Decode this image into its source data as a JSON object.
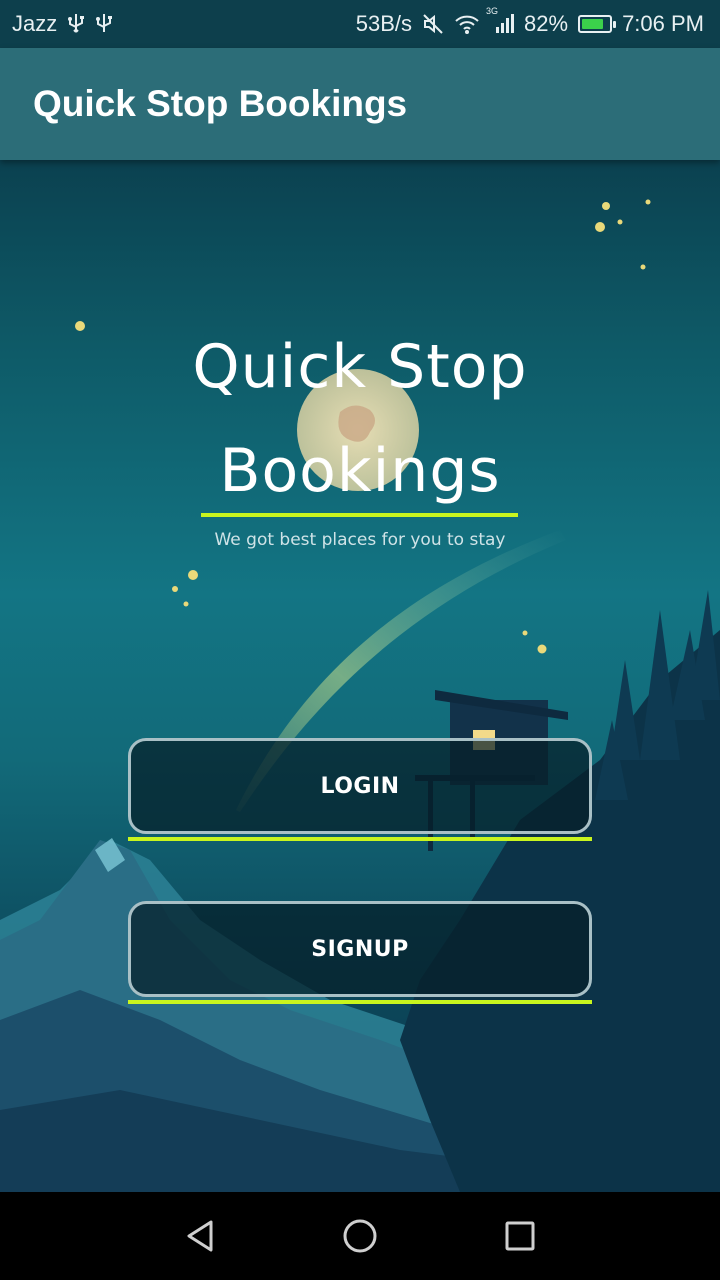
{
  "status_bar": {
    "carrier": "Jazz",
    "net_speed": "53B/s",
    "network_type": "3G",
    "battery": "82%",
    "battery_level": 0.82,
    "time": "7:06 PM",
    "icons": [
      "usb-icon",
      "usb-icon",
      "mute-icon",
      "wifi-icon",
      "signal-icon",
      "battery-icon"
    ]
  },
  "app_bar": {
    "title": "Quick Stop Bookings"
  },
  "hero": {
    "title_line1": "Quick Stop",
    "title_line2": "Bookings",
    "tagline": "We got best places for you to stay"
  },
  "buttons": {
    "login": "LOGIN",
    "signup": "SIGNUP"
  },
  "nav_bar": {
    "icons": [
      "back-icon",
      "home-icon",
      "recents-icon"
    ]
  },
  "colors": {
    "accent_underline": "#c9f51e",
    "app_bar": "#2c6d78",
    "status_bar": "#0d3f4c"
  }
}
